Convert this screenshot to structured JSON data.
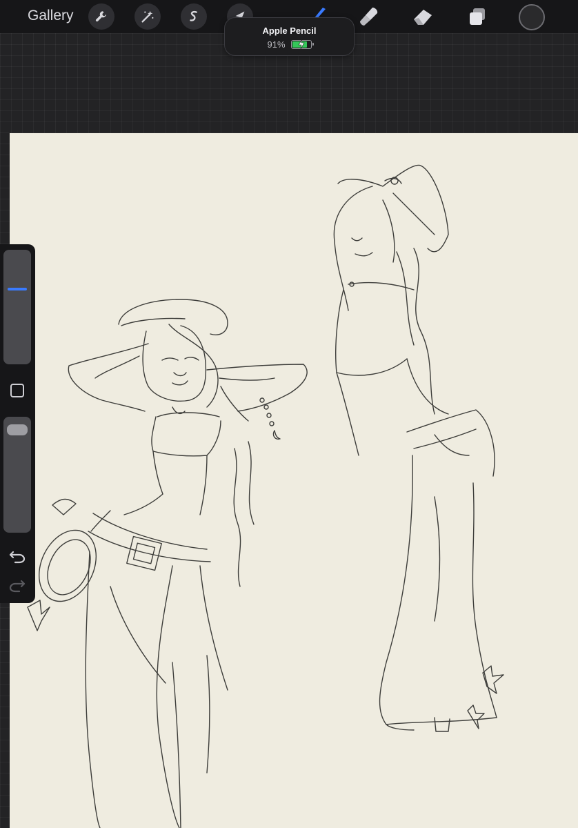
{
  "topbar": {
    "gallery_label": "Gallery",
    "tools": [
      "wrench-icon",
      "magic-wand-icon",
      "selection-icon",
      "transform-icon",
      "brush-icon",
      "smudge-icon",
      "eraser-icon",
      "layers-icon"
    ],
    "active_tool": "brush-icon",
    "accent": "#3a7bff",
    "current_color": "#2a2a2c"
  },
  "pencil_hud": {
    "title": "Apple Pencil",
    "battery_label": "91%",
    "battery_level": 0.91,
    "battery_color": "#34c759"
  },
  "canvas": {
    "background": "#efece0",
    "content": "line-art sketch"
  },
  "sidebar": {
    "brush_size_level": 0.38,
    "opacity_level": 0.05,
    "icons": [
      "modify-square-icon",
      "undo-icon",
      "redo-icon"
    ]
  }
}
